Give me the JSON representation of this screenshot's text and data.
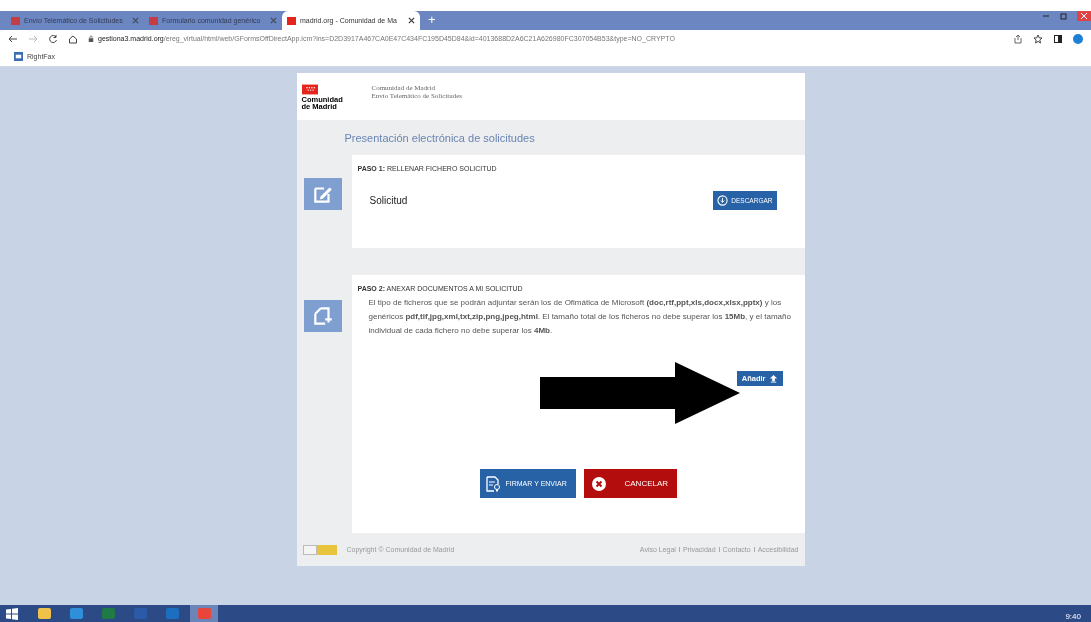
{
  "browser": {
    "tabs": [
      {
        "title": "Envío Telemático de Solicitudes",
        "selected": false
      },
      {
        "title": "Formulario comunidad genérico",
        "selected": false
      },
      {
        "title": "madrid.org - Comunidad de Ma",
        "selected": true
      }
    ],
    "new_tab": "+",
    "url": {
      "host": "gestiona3.madrid.org",
      "path": "/ereg_virtual/html/web/GFormsOffDirectApp.icm?ins=D2D3917A467CA0E47C434FC195D45D84&id=4013688D2A6C21A626980FC307054B53&type=NO_CRYPTO"
    },
    "bookmarks": [
      "RightFax"
    ]
  },
  "page": {
    "logo_text": "Comunidad de Madrid",
    "header": {
      "org": "Comunidad de Madrid",
      "service": "Envío Telemático de Solicitudes"
    },
    "title": "Presentación electrónica de solicitudes",
    "steps": [
      {
        "kind": "download",
        "label": "**PASO 1:** RELLENAR FICHERO SOLICITUD",
        "item": "Solicitud",
        "button": "DESCARGAR"
      },
      {
        "kind": "attach",
        "label": "**PASO 2:** ANEXAR DOCUMENTOS A MI SOLICITUD",
        "description": "El tipo de ficheros que se podrán adjuntar serán los de Ofimática de Microsoft **(doc,rtf,ppt,xls,docx,xlsx,pptx)** y los genéricos **pdf,tif,jpg,xml,txt,zip,png,jpeg,html**. El tamaño total de los ficheros no debe superar los **15Mb**, y el tamaño individual de cada fichero no debe superar los **4Mb**.",
        "button": "Añadir"
      }
    ],
    "actions": [
      {
        "kind": "sign",
        "label": "FIRMAR Y ENVIAR"
      },
      {
        "kind": "cancel",
        "label": "CANCELAR"
      }
    ],
    "footer": {
      "copyright": "Copyright © Comunidad de Madrid",
      "links": [
        "Aviso Legal",
        "Privacidad",
        "Contacto",
        "Accesibilidad"
      ]
    }
  },
  "taskbar": {
    "apps": [
      {
        "kind": "explorer",
        "selected": false
      },
      {
        "kind": "ie",
        "selected": false
      },
      {
        "kind": "excel",
        "selected": false
      },
      {
        "kind": "word",
        "selected": false
      },
      {
        "kind": "outlook",
        "selected": false
      },
      {
        "kind": "chrome",
        "selected": true
      }
    ],
    "clock": "9:40"
  }
}
